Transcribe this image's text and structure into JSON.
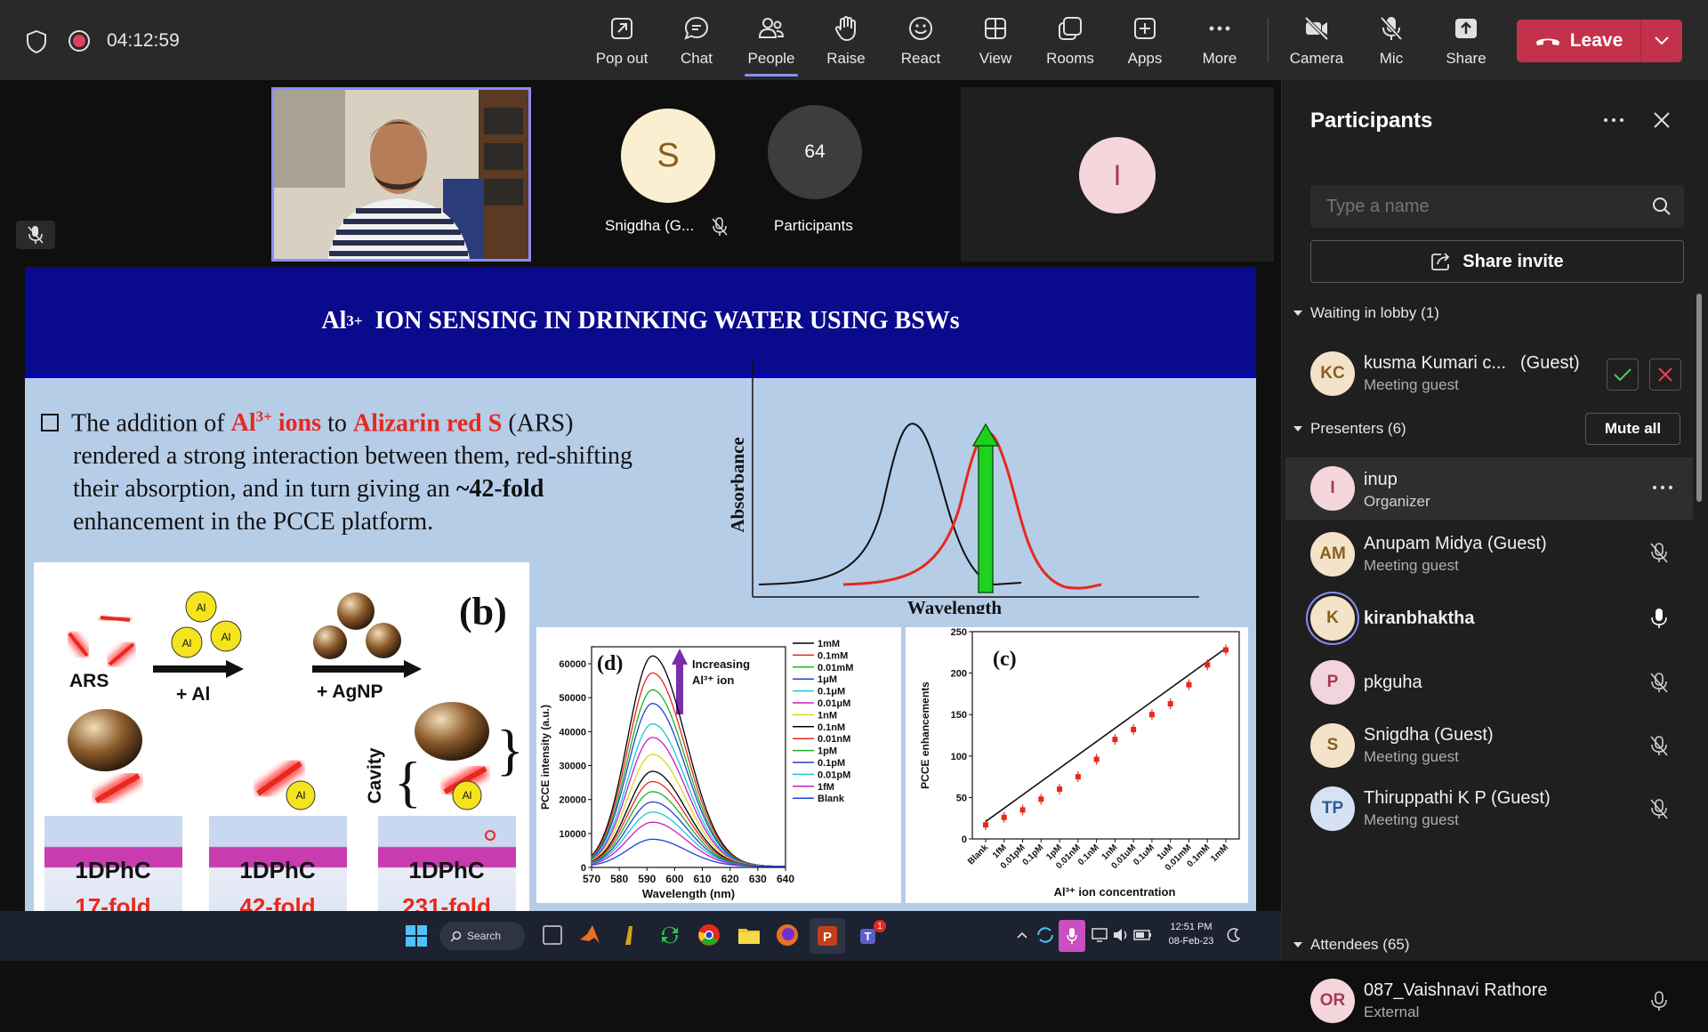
{
  "topbar": {
    "timer": "04:12:59",
    "buttons": [
      {
        "id": "popout",
        "label": "Pop out",
        "icon": "pop-out-icon"
      },
      {
        "id": "chat",
        "label": "Chat",
        "icon": "chat-icon"
      },
      {
        "id": "people",
        "label": "People",
        "icon": "people-icon"
      },
      {
        "id": "raise",
        "label": "Raise",
        "icon": "raise-hand-icon"
      },
      {
        "id": "react",
        "label": "React",
        "icon": "react-icon"
      },
      {
        "id": "view",
        "label": "View",
        "icon": "view-icon"
      },
      {
        "id": "rooms",
        "label": "Rooms",
        "icon": "rooms-icon"
      },
      {
        "id": "apps",
        "label": "Apps",
        "icon": "apps-icon"
      },
      {
        "id": "more",
        "label": "More",
        "icon": "more-icon"
      },
      {
        "id": "camera",
        "label": "Camera",
        "icon": "camera-off-icon"
      },
      {
        "id": "mic",
        "label": "Mic",
        "icon": "mic-off-icon"
      },
      {
        "id": "share",
        "label": "Share",
        "icon": "share-icon"
      }
    ],
    "leave_label": "Leave"
  },
  "stage": {
    "tile_s_initial": "S",
    "tile_s_name": "Snigdha (G...",
    "tile_count": "64",
    "tile_count_label": "Participants",
    "tile_i_initial": "I",
    "presenter_name": "kiranbhaktha"
  },
  "slide": {
    "title_sup": "3+",
    "title_pre": "Al",
    "title_rest": "ION SENSING IN DRINKING WATER USING BSWs",
    "bullet_1a": "The addition of ",
    "bullet_al": "Al",
    "bullet_al_sup": "3+",
    "bullet_ions": " ions",
    "bullet_to": " to ",
    "bullet_ars": "Alizarin red S",
    "bullet_1b": " (ARS)",
    "bullet_2": "rendered a strong interaction between them, red-shifting",
    "bullet_3a": "their absorption, and in turn giving an ",
    "bullet_3b": "~42-fold",
    "bullet_4": "enhancement in the PCCE platform.",
    "abs_ylabel": "Absorbance",
    "abs_xlabel": "Wavelength",
    "panel_b": {
      "label": "(b)",
      "ars": "ARS",
      "plus_al": "+ Al",
      "plus_agnp": "+ AgNP",
      "al_badge": "Al",
      "cavity": "Cavity",
      "phc1": "1DPhC",
      "phc2": "1DPhC",
      "phc3": "1DPhC",
      "fold1": "17-fold",
      "fold2": "42-fold",
      "fold3": "231-fold"
    }
  },
  "chart_data": [
    {
      "type": "line",
      "title": "(d)",
      "xlabel": "Wavelength (nm)",
      "ylabel": "PCCE intensity (a.u.)",
      "annotation": "Increasing Al³⁺ ion",
      "xlim": [
        570,
        640
      ],
      "ylim": [
        0,
        65000
      ],
      "xticks": [
        "570",
        "580",
        "590",
        "600",
        "610",
        "620",
        "630",
        "640"
      ],
      "yticks": [
        "0",
        "10000",
        "20000",
        "30000",
        "40000",
        "50000",
        "60000"
      ],
      "peak_x": 592,
      "series": [
        {
          "name": "1mM",
          "color": "#000000",
          "peak": 62000
        },
        {
          "name": "0.1mM",
          "color": "#e8281e",
          "peak": 57000
        },
        {
          "name": "0.01mM",
          "color": "#1fb01f",
          "peak": 52000
        },
        {
          "name": "1μM",
          "color": "#2240d8",
          "peak": 48000
        },
        {
          "name": "0.1μM",
          "color": "#19c8d8",
          "peak": 42000
        },
        {
          "name": "0.01μM",
          "color": "#c81ec8",
          "peak": 38000
        },
        {
          "name": "1nM",
          "color": "#d8d81e",
          "peak": 33000
        },
        {
          "name": "0.1nM",
          "color": "#000000",
          "peak": 28000
        },
        {
          "name": "0.01nM",
          "color": "#e8281e",
          "peak": 25000
        },
        {
          "name": "1pM",
          "color": "#1fb01f",
          "peak": 22000
        },
        {
          "name": "0.1pM",
          "color": "#2240d8",
          "peak": 19000
        },
        {
          "name": "0.01pM",
          "color": "#19c8d8",
          "peak": 16000
        },
        {
          "name": "1fM",
          "color": "#c81ec8",
          "peak": 13000
        },
        {
          "name": "Blank",
          "color": "#2240d8",
          "peak": 8000
        }
      ]
    },
    {
      "type": "scatter",
      "title": "(c)",
      "xlabel": "Al³⁺ ion concentration",
      "ylabel": "PCCE enhancements",
      "ylim": [
        0,
        250
      ],
      "yticks": [
        "0",
        "50",
        "100",
        "150",
        "200",
        "250"
      ],
      "categories": [
        "Blank",
        "1fM",
        "0.01pM",
        "0.1pM",
        "1pM",
        "0.01nM",
        "0.1nM",
        "1nM",
        "0.01uM",
        "0.1uM",
        "1uM",
        "0.01mM",
        "0.1mM",
        "1mM"
      ],
      "values": [
        17,
        26,
        35,
        48,
        60,
        75,
        96,
        120,
        132,
        150,
        163,
        186,
        210,
        228
      ]
    }
  ],
  "panel": {
    "title": "Participants",
    "search_placeholder": "Type a name",
    "share_invite": "Share invite",
    "lobby_header": "Waiting in lobby (1)",
    "lobby": [
      {
        "initials": "KC",
        "name": "kusma Kumari c...",
        "tag": "(Guest)",
        "sub": "Meeting guest",
        "bg": "#f3e3c8",
        "fg": "#8a5d1e"
      }
    ],
    "presenters_header": "Presenters (6)",
    "mute_all": "Mute all",
    "presenters": [
      {
        "initials": "I",
        "name": "inup",
        "sub": "Organizer",
        "bg": "#f4d6dc",
        "fg": "#a33b55",
        "mic": "more"
      },
      {
        "initials": "AM",
        "name": "Anupam Midya (Guest)",
        "sub": "Meeting guest",
        "bg": "#f3e3c8",
        "fg": "#8a5d1e",
        "mic": "off"
      },
      {
        "initials": "K",
        "name": "kiranbhaktha",
        "sub": "",
        "bg": "#f3e3c8",
        "fg": "#8a5d1e",
        "mic": "on"
      },
      {
        "initials": "P",
        "name": "pkguha",
        "sub": "",
        "bg": "#f1d4dd",
        "fg": "#a33b55",
        "mic": "off"
      },
      {
        "initials": "S",
        "name": "Snigdha (Guest)",
        "sub": "Meeting guest",
        "bg": "#f3e3c8",
        "fg": "#8a5d1e",
        "mic": "off"
      },
      {
        "initials": "TP",
        "name": "Thiruppathi K P (Guest)",
        "sub": "Meeting guest",
        "bg": "#d6e2f3",
        "fg": "#2f5b93",
        "mic": "off"
      }
    ],
    "attendees_header": "Attendees (65)",
    "attendees": [
      {
        "initials": "OR",
        "name": "087_Vaishnavi Rathore",
        "sub": "External",
        "bg": "#f4d6dc",
        "fg": "#a33b55"
      }
    ]
  },
  "taskbar": {
    "search_label": "Search",
    "time": "12:51 PM",
    "date": "08-Feb-23",
    "teams_badge": "1"
  }
}
